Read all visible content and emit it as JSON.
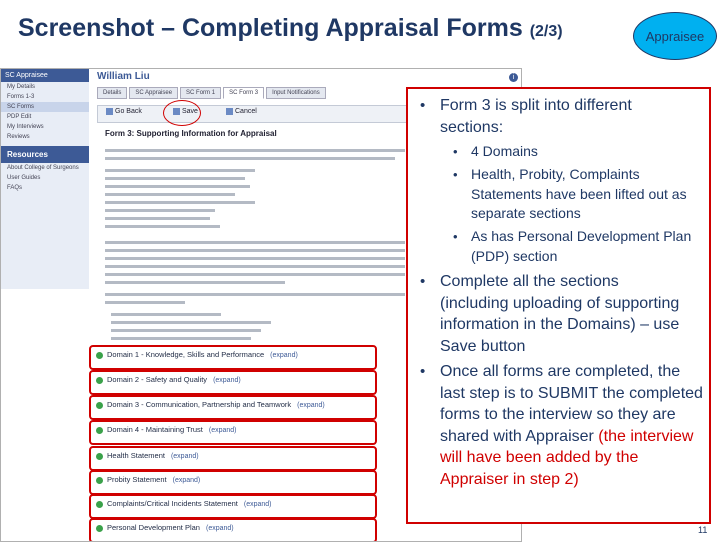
{
  "slide": {
    "title": "Screenshot – Completing Appraisal Forms",
    "title_suffix": "(2/3)",
    "badge": "Appraisee",
    "page_number": "11"
  },
  "screenshot": {
    "user_name": "William Liu",
    "sidebar": {
      "header": "SC Appraisee",
      "items": [
        "My Details",
        "Forms 1-3",
        "SC Forms",
        "PDP Edit",
        "My Interviews",
        "Reviews"
      ],
      "resources_label": "Resources",
      "resource_items": [
        "About College of Surgeons",
        "User Guides",
        "FAQs"
      ]
    },
    "tabs": [
      "Details",
      "SC Appraisee",
      "SC Form 1",
      "SC Form 3",
      "Input Notifications"
    ],
    "toolbar": {
      "back": "Go Back",
      "save": "Save",
      "cancel": "Cancel"
    },
    "form_title": "Form 3: Supporting Information for Appraisal",
    "sections": [
      {
        "label": "Domain 1 - Knowledge, Skills and Performance",
        "action": "(expand)"
      },
      {
        "label": "Domain 2 - Safety and Quality",
        "action": "(expand)"
      },
      {
        "label": "Domain 3 - Communication, Partnership and Teamwork",
        "action": "(expand)"
      },
      {
        "label": "Domain 4 - Maintaining Trust",
        "action": "(expand)"
      },
      {
        "label": "Health Statement",
        "action": "(expand)"
      },
      {
        "label": "Probity Statement",
        "action": "(expand)"
      },
      {
        "label": "Complaints/Critical Incidents Statement",
        "action": "(expand)"
      },
      {
        "label": "Personal Development Plan",
        "action": "(expand)"
      }
    ]
  },
  "notes": {
    "b1": "Form 3 is split into different sections:",
    "b1_sub": [
      "4 Domains",
      "Health, Probity, Complaints Statements have been lifted out as separate sections",
      "As has Personal Development Plan (PDP) section"
    ],
    "b2": "Complete all the sections (including uploading of supporting information in the Domains) – use Save button",
    "b3": "Once all forms are completed, the last step is to SUBMIT the completed forms to the interview so they are shared with Appraiser",
    "b3_red": " (the interview will have been added by the Appraiser in step 2)"
  }
}
